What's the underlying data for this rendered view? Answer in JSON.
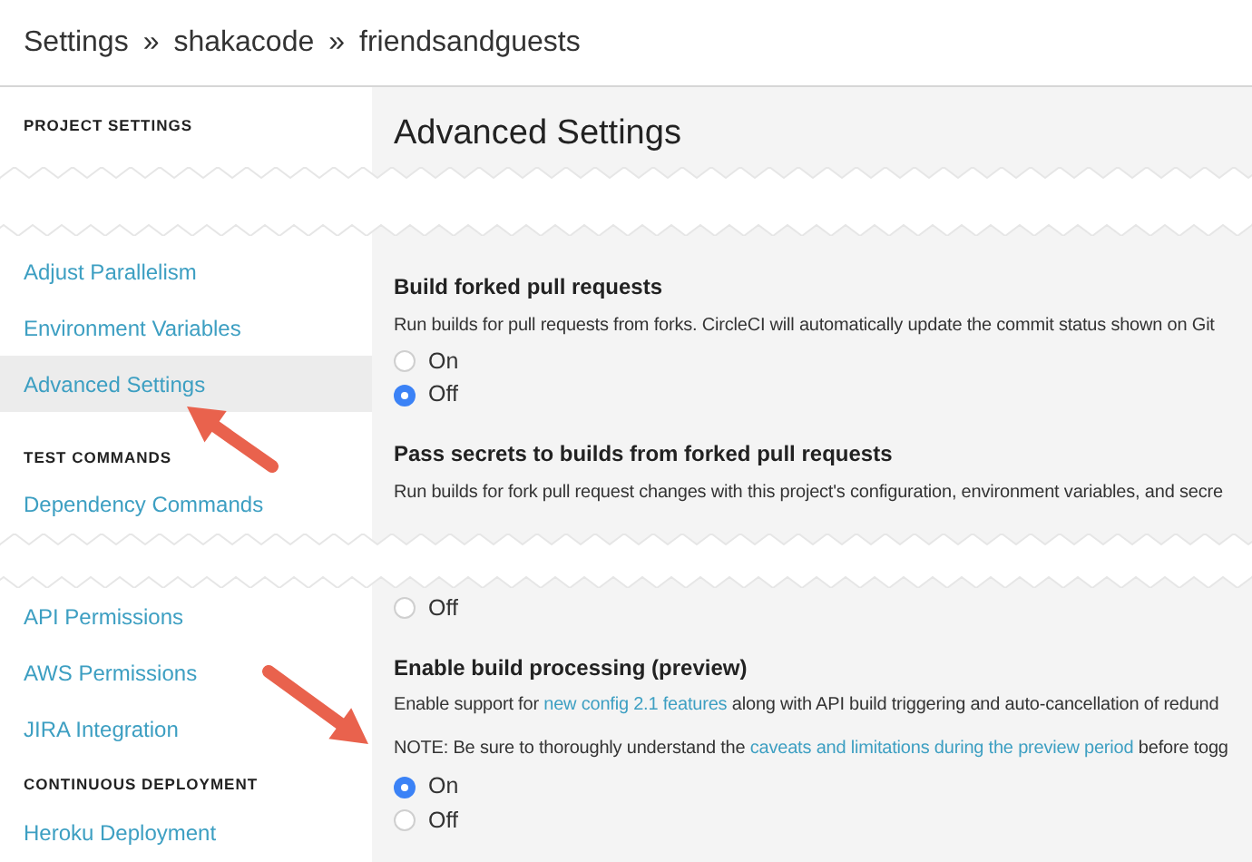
{
  "breadcrumb": {
    "separator": "»",
    "parts": [
      "Settings",
      "shakacode",
      "friendsandguests"
    ]
  },
  "sidebar": {
    "sections": [
      {
        "heading": "PROJECT SETTINGS",
        "items": [
          {
            "label": "Adjust Parallelism",
            "selected": false
          },
          {
            "label": "Environment Variables",
            "selected": false
          },
          {
            "label": "Advanced Settings",
            "selected": true
          }
        ]
      },
      {
        "heading": "TEST COMMANDS",
        "items": [
          {
            "label": "Dependency Commands",
            "selected": false
          }
        ]
      },
      {
        "items": [
          {
            "label": "API Permissions",
            "selected": false
          },
          {
            "label": "AWS Permissions",
            "selected": false
          },
          {
            "label": "JIRA Integration",
            "selected": false
          }
        ]
      },
      {
        "heading": "CONTINUOUS DEPLOYMENT",
        "items": [
          {
            "label": "Heroku Deployment",
            "selected": false
          }
        ]
      }
    ]
  },
  "main": {
    "title": "Advanced Settings",
    "settings": [
      {
        "title": "Build forked pull requests",
        "paragraphs": [
          [
            {
              "text": "Run builds for pull requests from forks. CircleCI will automatically update the commit status shown on Git",
              "link": false
            }
          ]
        ],
        "options": [
          {
            "label": "On",
            "selected": false
          },
          {
            "label": "Off",
            "selected": true
          }
        ]
      },
      {
        "title": "Pass secrets to builds from forked pull requests",
        "paragraphs": [
          [
            {
              "text": "Run builds for fork pull request changes with this project's configuration, environment variables, and secre",
              "link": false
            }
          ]
        ],
        "options": [
          {
            "label": "Off",
            "selected": false
          }
        ]
      },
      {
        "title": "Enable build processing (preview)",
        "paragraphs": [
          [
            {
              "text": "Enable support for ",
              "link": false
            },
            {
              "text": "new config 2.1 features",
              "link": true
            },
            {
              "text": " along with API build triggering and auto-cancellation of redund",
              "link": false
            }
          ],
          [
            {
              "text": "NOTE: Be sure to thoroughly understand the ",
              "link": false
            },
            {
              "text": "caveats and limitations during the preview period",
              "link": true
            },
            {
              "text": " before togg",
              "link": false
            }
          ]
        ],
        "options": [
          {
            "label": "On",
            "selected": true
          },
          {
            "label": "Off",
            "selected": false
          }
        ]
      }
    ]
  }
}
